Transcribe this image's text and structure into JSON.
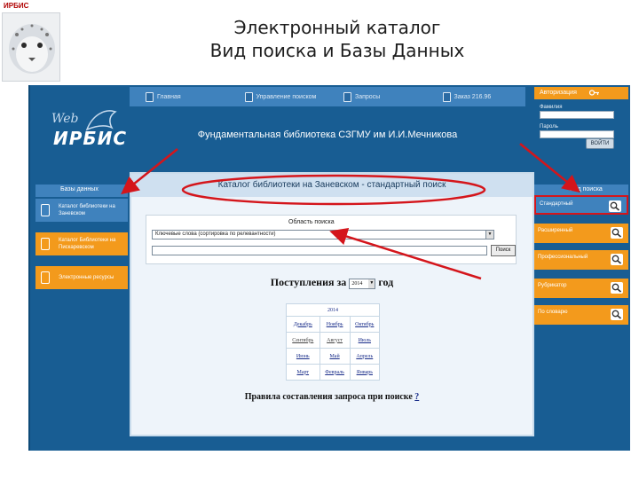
{
  "slide": {
    "logo_text": "ИРБИС",
    "title_line1": "Электронный каталог",
    "title_line2": "Вид поиска и Базы Данных"
  },
  "topnav": {
    "items": [
      {
        "label": "Главная",
        "icon": "home-icon"
      },
      {
        "label": "Управление поиском",
        "icon": "search-settings-icon"
      },
      {
        "label": "Запросы",
        "icon": "queries-icon"
      },
      {
        "label": "Заказ 216.96",
        "icon": "order-icon"
      }
    ]
  },
  "auth": {
    "title": "Авторизация",
    "login_label": "Фамилия",
    "password_label": "Пароль",
    "button": "ВОЙТИ"
  },
  "brand": {
    "web": "Web",
    "irbis": "ИРБИС",
    "library_title": "Фундаментальная библиотека СЗГМУ им И.И.Мечникова"
  },
  "databases": {
    "title": "Базы данных",
    "items": [
      {
        "label": "Каталог библиотеки на Заневском",
        "selected": true
      },
      {
        "label": "Каталог Библиотеки на Пискаревском",
        "selected": false
      },
      {
        "label": "Электронные ресурсы",
        "selected": false
      }
    ]
  },
  "catalog": {
    "header": "Каталог библиотеки на Заневском - стандартный поиск",
    "area_label": "Область поиска",
    "area_value": "Ключевые слова (сортировка по релевантности)",
    "find_button": "Поиск",
    "arrivals_label": "Поступления за",
    "arrivals_year": "2014",
    "arrivals_suffix": "год",
    "year_header": "2014",
    "months": [
      [
        "Декабрь",
        "Ноябрь",
        "Октябрь"
      ],
      [
        "Сентябрь",
        "Август",
        "Июль"
      ],
      [
        "Июнь",
        "Май",
        "Апрель"
      ],
      [
        "Март",
        "Февраль",
        "Январь"
      ]
    ],
    "rules_text": "Правила составления запроса при поиске",
    "rules_link": "?"
  },
  "search_types": {
    "title": "Вид поиска",
    "items": [
      {
        "label": "Стандартный",
        "selected": true
      },
      {
        "label": "Расширенный",
        "selected": false
      },
      {
        "label": "Профессиональный",
        "selected": false
      },
      {
        "label": "Рубрикатор",
        "selected": false
      },
      {
        "label": "По словарю",
        "selected": false
      }
    ]
  },
  "colors": {
    "page_background": "#185d93",
    "nav_blue": "#3f82bd",
    "accent_orange": "#f39a1c",
    "annotation_red": "#d4151b"
  }
}
